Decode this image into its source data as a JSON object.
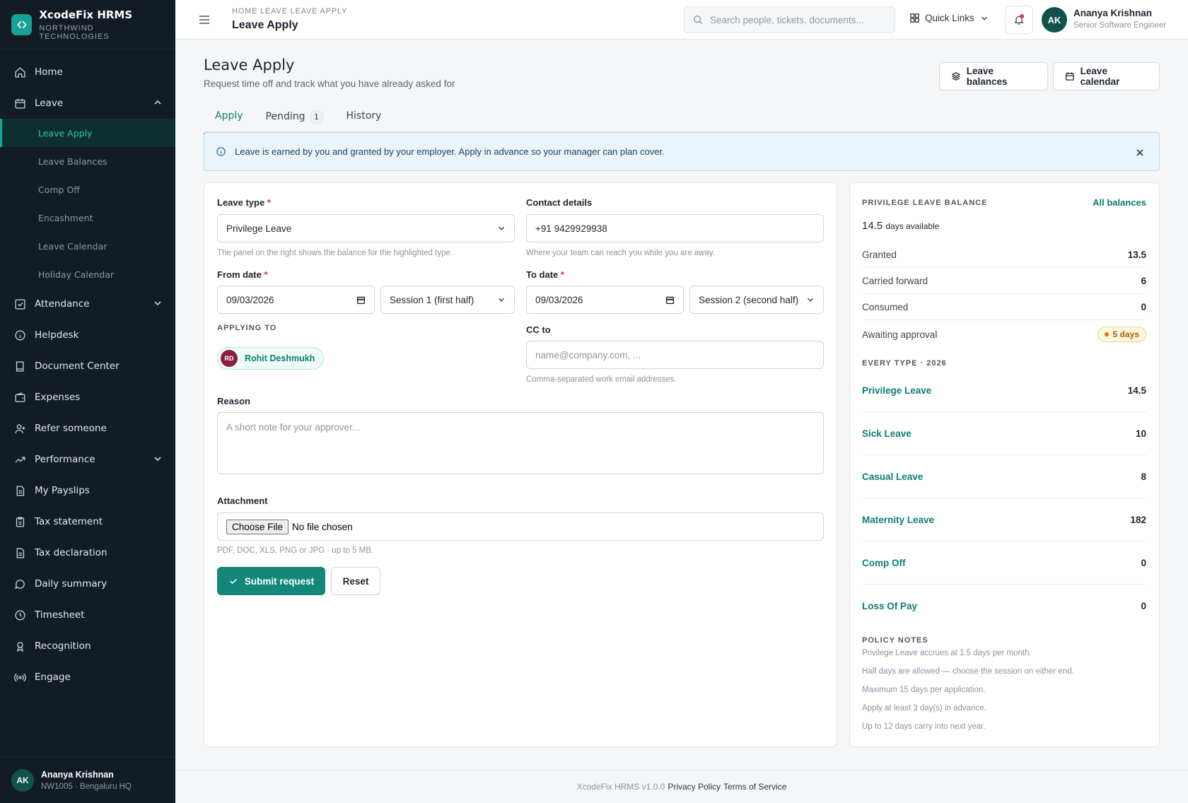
{
  "brand": {
    "name": "XcodeFix HRMS",
    "org": "NORTHWIND TECHNOLOGIES"
  },
  "sidebar": {
    "items": [
      {
        "label": "Home",
        "icon": "home-icon"
      },
      {
        "label": "Leave",
        "icon": "calendar-icon"
      }
    ],
    "leave_sub": [
      "Leave Apply",
      "Leave Balances",
      "Comp Off",
      "Encashment",
      "Leave Calendar",
      "Holiday Calendar"
    ],
    "more": [
      "Attendance",
      "Helpdesk",
      "Document Center",
      "Expenses",
      "Refer someone",
      "Performance",
      "My Payslips",
      "Tax statement",
      "Tax declaration",
      "Daily summary",
      "Timesheet",
      "Recognition",
      "Engage"
    ],
    "user": {
      "initials": "AK",
      "name": "Ananya Krishnan",
      "meta": "NW1005 · Bengaluru HQ"
    }
  },
  "topbar": {
    "breadcrumb": "HOME  LEAVE  LEAVE APPLY",
    "title": "Leave Apply",
    "search_placeholder": "Search people, tickets, documents...",
    "quick_links": "Quick Links",
    "user": {
      "initials": "AK",
      "name": "Ananya Krishnan",
      "role": "Senior Software Engineer"
    }
  },
  "page": {
    "title": "Leave Apply",
    "subtitle": "Request time off and track what you have already asked for",
    "btn_balances": "Leave balances",
    "btn_calendar": "Leave calendar",
    "tabs": [
      {
        "label": "Apply"
      },
      {
        "label": "Pending",
        "count": "1"
      },
      {
        "label": "History"
      }
    ],
    "alert": "Leave is earned by you and granted by your employer. Apply in advance so your manager can plan cover."
  },
  "form": {
    "leave_type_label": "Leave type",
    "leave_type_value": "Privilege Leave",
    "leave_type_hint": "The panel on the right shows the balance for the highlighted type.",
    "contact_label": "Contact details",
    "contact_value": "+91 9429929938",
    "contact_hint": "Where your team can reach you while you are away.",
    "from_label": "From date",
    "from_value": "09/03/2026",
    "from_session": "Session 1 (first half)",
    "to_label": "To date",
    "to_value": "09/03/2026",
    "to_session": "Session 2 (second half)",
    "applying_to_label": "APPLYING TO",
    "approver_initials": "RD",
    "approver_name": "Rohit Deshmukh",
    "cc_label": "CC to",
    "cc_placeholder": "name@company.com, ...",
    "cc_hint": "Comma-separated work email addresses.",
    "reason_label": "Reason",
    "reason_placeholder": "A short note for your approver...",
    "attachment_label": "Attachment",
    "file_button": "Choose File",
    "file_status": "No file chosen",
    "attachment_hint": "PDF, DOC, XLS, PNG or JPG · up to 5 MB.",
    "submit": "Submit request",
    "reset": "Reset"
  },
  "balance": {
    "heading": "PRIVILEGE LEAVE BALANCE",
    "all_link": "All balances",
    "available_num": "14.5",
    "available_txt": "days available",
    "rows": [
      {
        "label": "Granted",
        "value": "13.5"
      },
      {
        "label": "Carried forward",
        "value": "6"
      },
      {
        "label": "Consumed",
        "value": "0"
      }
    ],
    "awaiting_label": "Awaiting approval",
    "awaiting_value": "5 days",
    "types_heading": "EVERY TYPE · 2026",
    "types": [
      {
        "name": "Privilege Leave",
        "value": "14.5"
      },
      {
        "name": "Sick Leave",
        "value": "10"
      },
      {
        "name": "Casual Leave",
        "value": "8"
      },
      {
        "name": "Maternity Leave",
        "value": "182"
      },
      {
        "name": "Comp Off",
        "value": "0"
      },
      {
        "name": "Loss Of Pay",
        "value": "0"
      }
    ],
    "notes_heading": "POLICY NOTES",
    "notes": [
      "Privilege Leave accrues at 1.5 days per month.",
      "Half days are allowed — choose the session on either end.",
      "Maximum 15 days per application.",
      "Apply at least 3 day(s) in advance.",
      "Up to 12 days carry into next year."
    ]
  },
  "footer": {
    "version": "XcodeFix HRMS v1.0.0",
    "privacy": "Privacy Policy",
    "terms": "Terms of Service"
  },
  "colors": {
    "accent": "#0f7d72",
    "sidebar": "#131c25",
    "danger": "#d6343f"
  }
}
